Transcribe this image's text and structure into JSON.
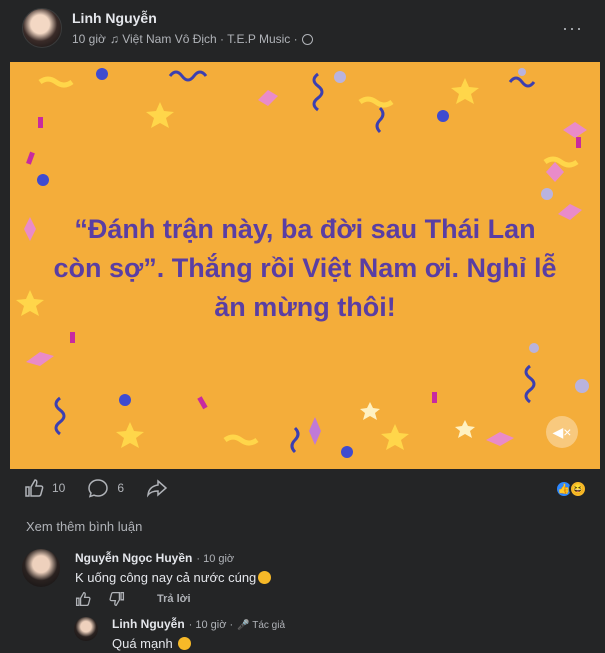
{
  "post": {
    "author": "Linh Nguyễn",
    "time": "10 giờ",
    "music": "♫ Việt Nam Vô Địch · T.E.P Music ·",
    "more": "···",
    "text": "“Đánh trận này, ba đời sau Thái Lan còn sợ”. Thắng rồi Việt Nam ơi. Nghỉ lễ ăn mừng thôi!",
    "background_color": "#f4ad3a",
    "text_color": "#5a3ea3"
  },
  "actions": {
    "like_count": "10",
    "comment_count": "6",
    "like_icon": "thumbs-up-icon",
    "comment_icon": "comment-bubble-icon",
    "share_icon": "share-arrow-icon"
  },
  "see_more": "Xem thêm bình luận",
  "comments": [
    {
      "name": "Nguyễn Ngọc Huyền",
      "time": "· 10 giờ",
      "text": "K uống công nay cả nước cúng",
      "reply": "Trả lời"
    },
    {
      "name": "Linh Nguyễn",
      "time": "· 10 giờ ·",
      "tag": "🎤 Tác giả",
      "text": "Quá mạnh"
    }
  ]
}
